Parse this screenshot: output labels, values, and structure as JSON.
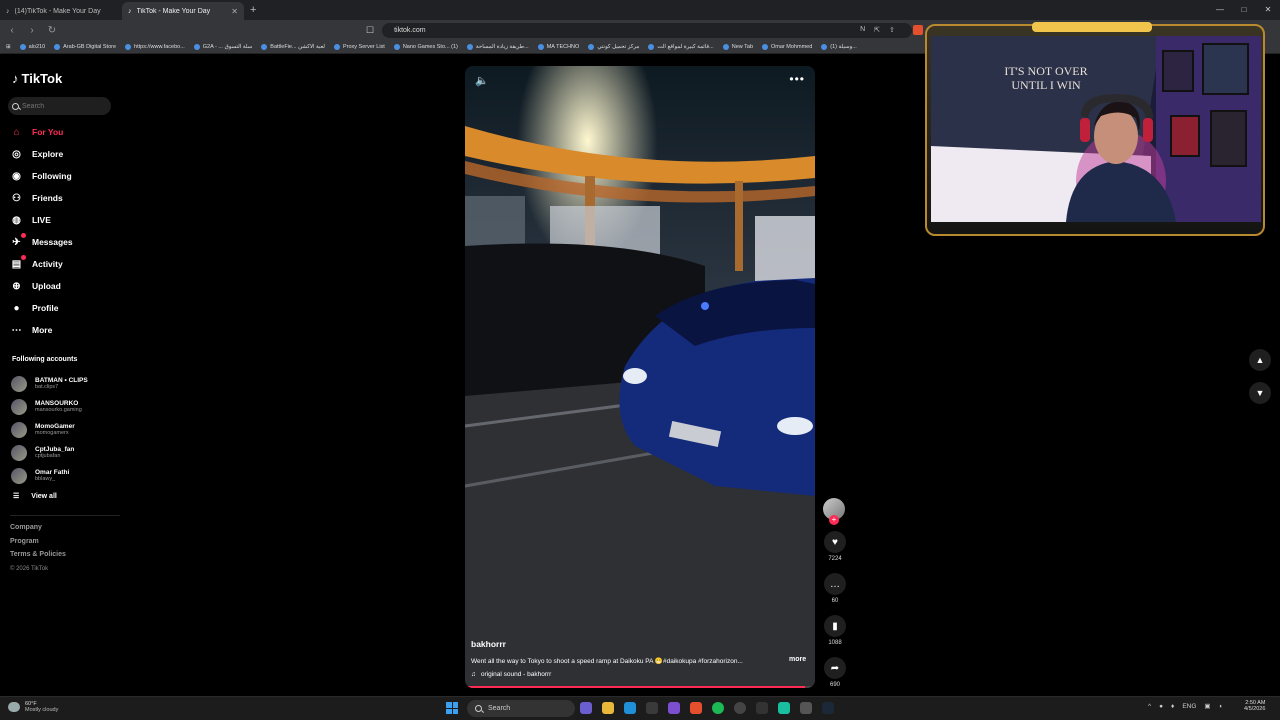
{
  "browser": {
    "tabs": [
      {
        "title": "(14)TikTok - Make Your Day",
        "active": false
      },
      {
        "title": "TikTok - Make Your Day",
        "active": true
      }
    ],
    "url": "tiktok.com",
    "bookmarks": [
      "alo210",
      "Arab-GB Digital Store",
      "https://www.facebo...",
      "G2A - ... سلة التسوق",
      "BattleFie... لعبة الاكشن",
      "Proxy Server List",
      "Nano Games Sto... (1)",
      "طريقة زيادة المساحة...",
      "MA TECHNO",
      "مركز تحميل كونتي",
      "قائمة كبيرة لمواقع الت...",
      "New Tab",
      "Omar Mohmmed",
      "(1) وسيلة..."
    ]
  },
  "tiktok": {
    "logo": "TikTok",
    "search_placeholder": "Search",
    "nav": [
      {
        "label": "For You",
        "icon": "home-icon"
      },
      {
        "label": "Explore",
        "icon": "compass-icon"
      },
      {
        "label": "Following",
        "icon": "following-icon"
      },
      {
        "label": "Friends",
        "icon": "friends-icon"
      },
      {
        "label": "LIVE",
        "icon": "live-icon"
      },
      {
        "label": "Messages",
        "icon": "messages-icon"
      },
      {
        "label": "Activity",
        "icon": "activity-icon"
      },
      {
        "label": "Upload",
        "icon": "upload-icon"
      },
      {
        "label": "Profile",
        "icon": "profile-icon"
      },
      {
        "label": "More",
        "icon": "more-icon"
      }
    ],
    "following_title": "Following accounts",
    "accounts": [
      {
        "name": "BATMAN • CLIPS",
        "handle": "bat.clips7"
      },
      {
        "name": "MANSOURKO",
        "handle": "mansourko.gaming"
      },
      {
        "name": "MomoGamer",
        "handle": "momogamerx"
      },
      {
        "name": "CptJuba_fan",
        "handle": "cptjubafan"
      },
      {
        "name": "Omar Fathi",
        "handle": "bblawy_"
      }
    ],
    "view_all": "View all",
    "footer": [
      "Company",
      "Program",
      "Terms & Policies"
    ],
    "copyright": "© 2026 TikTok"
  },
  "video": {
    "author": "bakhorrr",
    "caption": "Went all the way to Tokyo to shoot a speed ramp at Daikoku PA 😁#daikokupa #forzahorizon...",
    "more": "more",
    "sound": "original sound - bakhorrr",
    "progress": 0.98,
    "likes": "7224",
    "comments": "60",
    "saves": "1088",
    "shares": "690"
  },
  "webcam": {
    "banner_text": "IT'S NOT OVER UNTIL I WIN"
  },
  "taskbar": {
    "weather_temp": "60°F",
    "weather_cond": "Mostly cloudy",
    "search": "Search",
    "lang": "ENG",
    "time": "2:50 AM",
    "date": "4/5/2026"
  },
  "colors": {
    "accent": "#fe2c55",
    "bg": "#000000"
  }
}
